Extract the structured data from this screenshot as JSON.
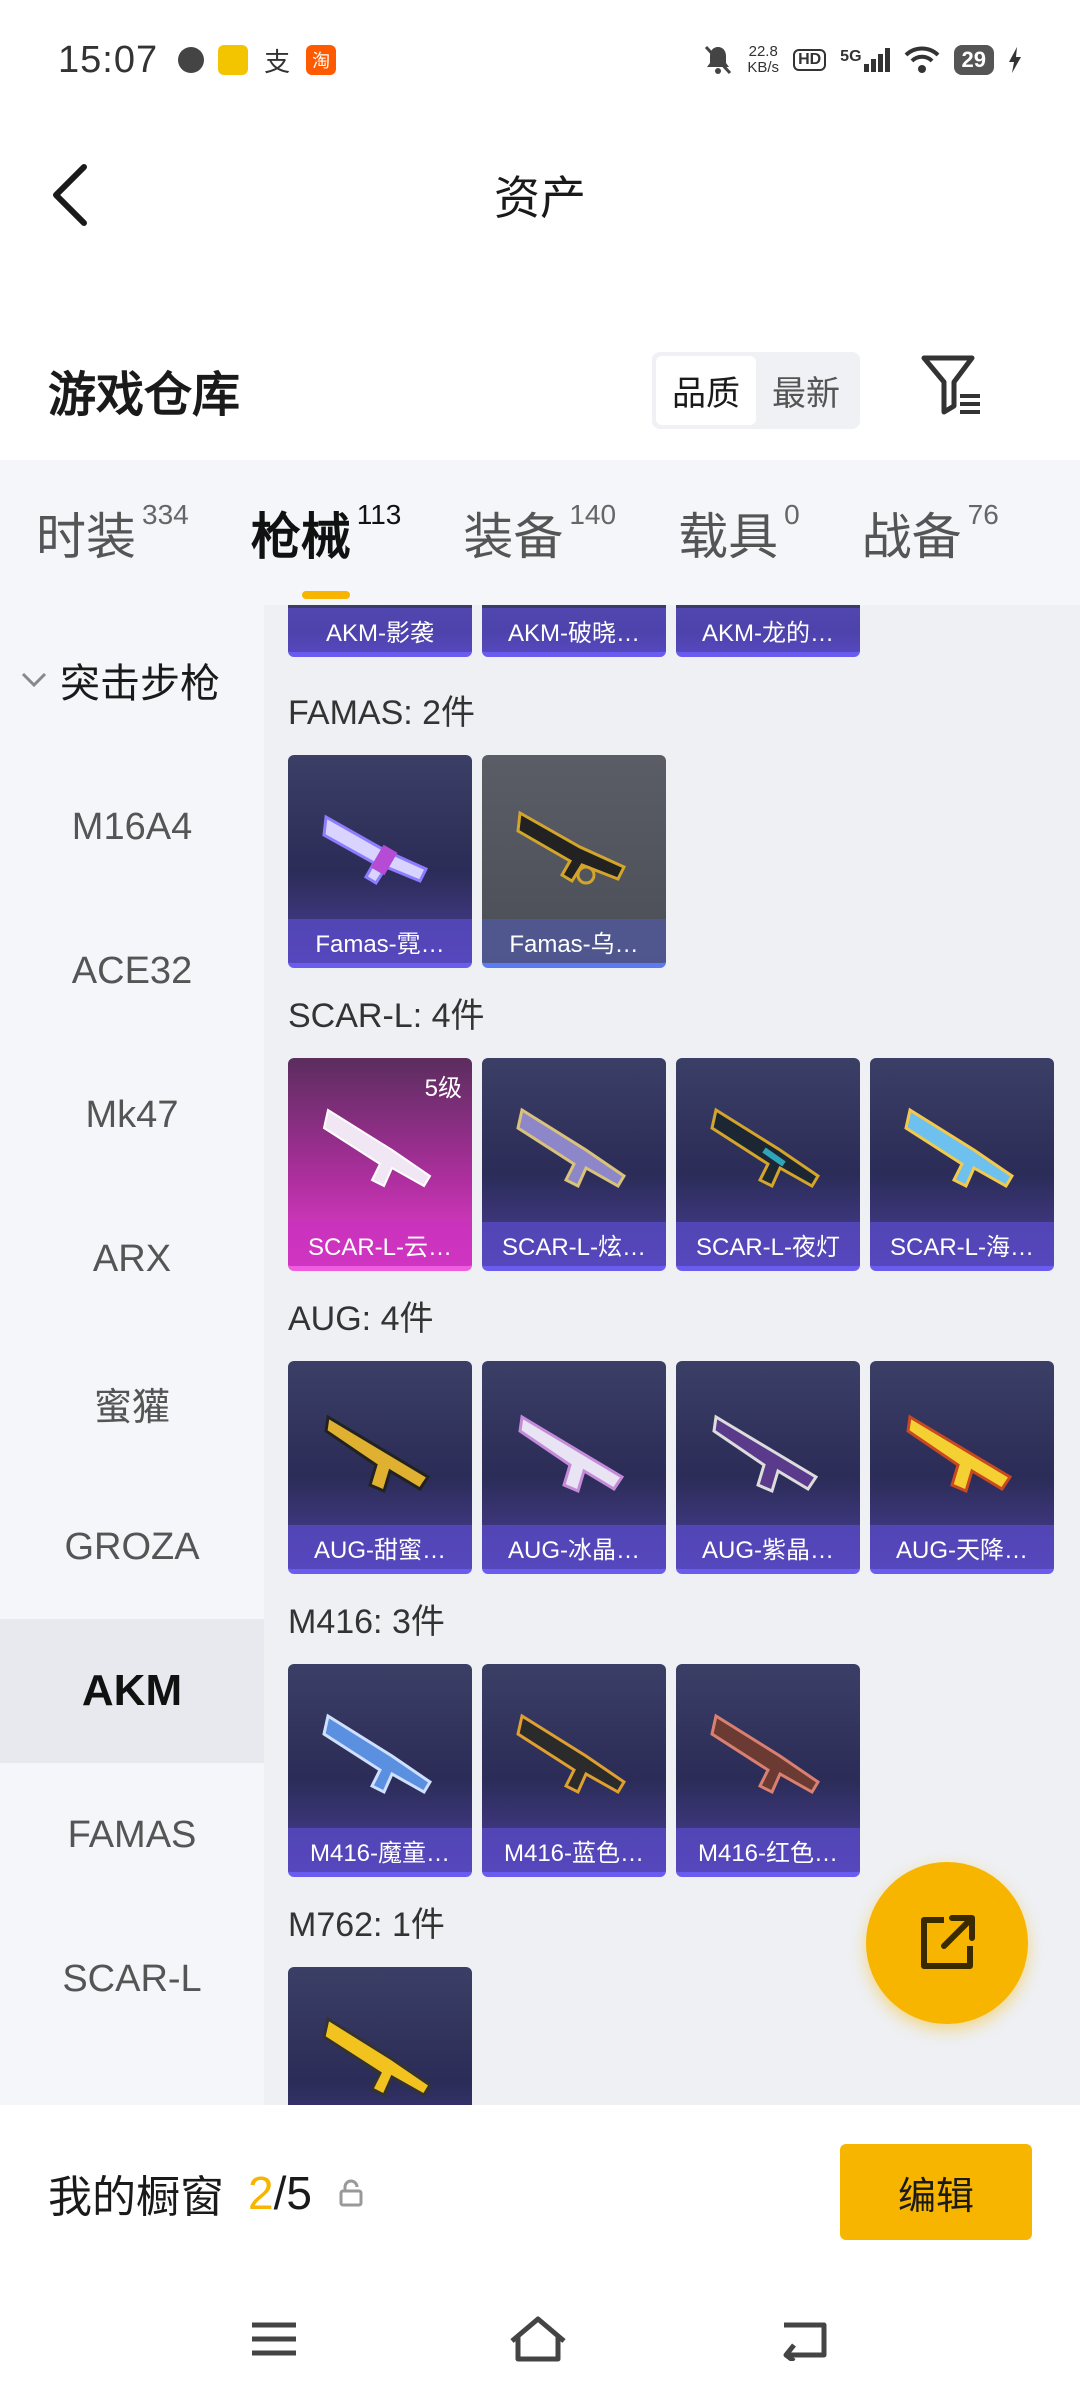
{
  "status_bar": {
    "time": "15:07",
    "apps": [
      "msg-app-icon",
      "wallet-app-icon",
      "alipay-icon",
      "taobao-icon"
    ],
    "net_speed_value": "22.8",
    "net_speed_unit": "KB/s",
    "hd_badge": "HD",
    "signal_label": "5G",
    "battery": "29"
  },
  "header": {
    "title": "资产"
  },
  "section": {
    "title": "游戏仓库",
    "sort_options": [
      "品质",
      "最新"
    ],
    "sort_active": "品质"
  },
  "tabs": [
    {
      "label": "时装",
      "count": "334"
    },
    {
      "label": "枪械",
      "count": "113",
      "active": true
    },
    {
      "label": "装备",
      "count": "140"
    },
    {
      "label": "载具",
      "count": "0"
    },
    {
      "label": "战备",
      "count": "76"
    }
  ],
  "sidebar": {
    "group": "突击步枪",
    "items": [
      "M16A4",
      "ACE32",
      "Mk47",
      "ARX",
      "蜜獾",
      "GROZA",
      "AKM",
      "FAMAS",
      "SCAR-L"
    ],
    "active": "AKM"
  },
  "content": {
    "akm_partial": [
      "AKM-影袭",
      "AKM-破晓…",
      "AKM-龙的…"
    ],
    "groups": [
      {
        "title": "FAMAS: 2件",
        "items": [
          {
            "label": "Famas-霓…",
            "style": "purple"
          },
          {
            "label": "Famas-乌…",
            "style": "grey"
          }
        ]
      },
      {
        "title": "SCAR-L: 4件",
        "items": [
          {
            "label": "SCAR-L-云…",
            "style": "pink",
            "level": "5级"
          },
          {
            "label": "SCAR-L-炫…",
            "style": "purple"
          },
          {
            "label": "SCAR-L-夜灯",
            "style": "purple"
          },
          {
            "label": "SCAR-L-海…",
            "style": "purple"
          }
        ]
      },
      {
        "title": "AUG: 4件",
        "items": [
          {
            "label": "AUG-甜蜜…",
            "style": "purple"
          },
          {
            "label": "AUG-冰晶…",
            "style": "purple"
          },
          {
            "label": "AUG-紫晶…",
            "style": "purple"
          },
          {
            "label": "AUG-天降…",
            "style": "purple"
          }
        ]
      },
      {
        "title": "M416: 3件",
        "items": [
          {
            "label": "M416-魔童…",
            "style": "purple"
          },
          {
            "label": "M416-蓝色…",
            "style": "purple"
          },
          {
            "label": "M416-红色…",
            "style": "purple"
          }
        ]
      },
      {
        "title": "M762: 1件",
        "items": [
          {
            "label": "",
            "style": "purple"
          }
        ]
      }
    ]
  },
  "showcase": {
    "label": "我的橱窗",
    "current": "2",
    "separator": "/",
    "total": "5",
    "edit_label": "编辑"
  },
  "colors": {
    "accent": "#f7b500",
    "card_purple": "#2b2c57",
    "card_pink": "#e63fcf"
  }
}
